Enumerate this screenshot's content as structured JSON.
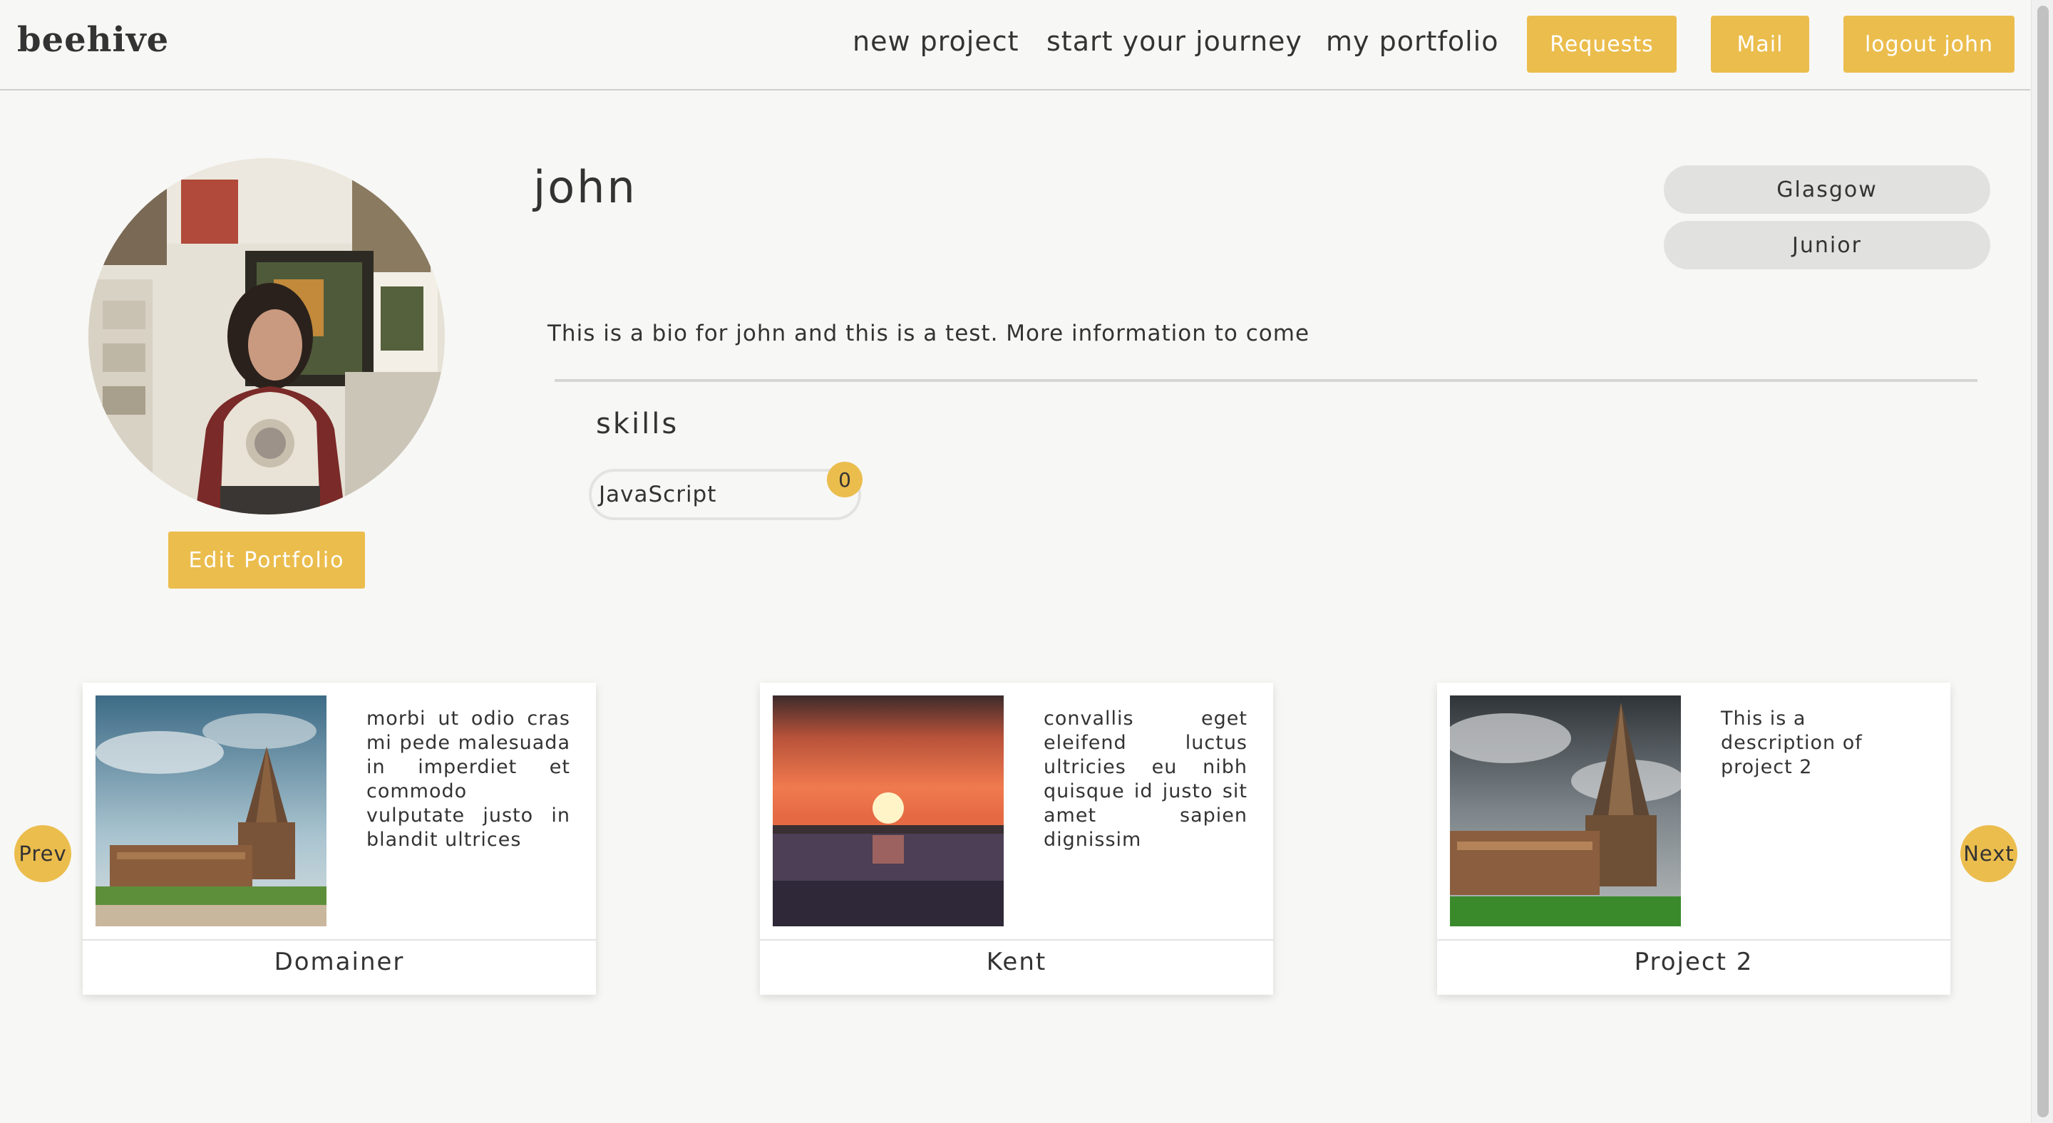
{
  "app": {
    "logo": "beehive"
  },
  "nav": {
    "links": [
      "new project",
      "start your journey",
      "my portfolio"
    ],
    "buttons": [
      "Requests",
      "Mail",
      "logout john"
    ]
  },
  "profile": {
    "name": "john",
    "location": "Glasgow",
    "level": "Junior",
    "bio": "This is a bio for john and this is a test. More information to come",
    "edit_label": "Edit Portfolio"
  },
  "skills": {
    "title": "skills",
    "items": [
      {
        "name": "JavaScript",
        "count": "0"
      }
    ]
  },
  "projects": [
    {
      "title": "Domainer",
      "description": "morbi ut odio cras mi pede malesuada in imperdiet et commodo vulputate justo in blandit ultrices"
    },
    {
      "title": "Kent",
      "description": "convallis eget eleifend luctus ultricies eu nibh quisque id justo sit amet sapien dignissim"
    },
    {
      "title": "Project 2",
      "description": "This is a description of project 2"
    }
  ],
  "carousel": {
    "prev": "Prev",
    "next": "Next"
  },
  "colors": {
    "accent": "#ebbd4d",
    "background": "#f7f7f5",
    "pill": "#e1e1df"
  }
}
